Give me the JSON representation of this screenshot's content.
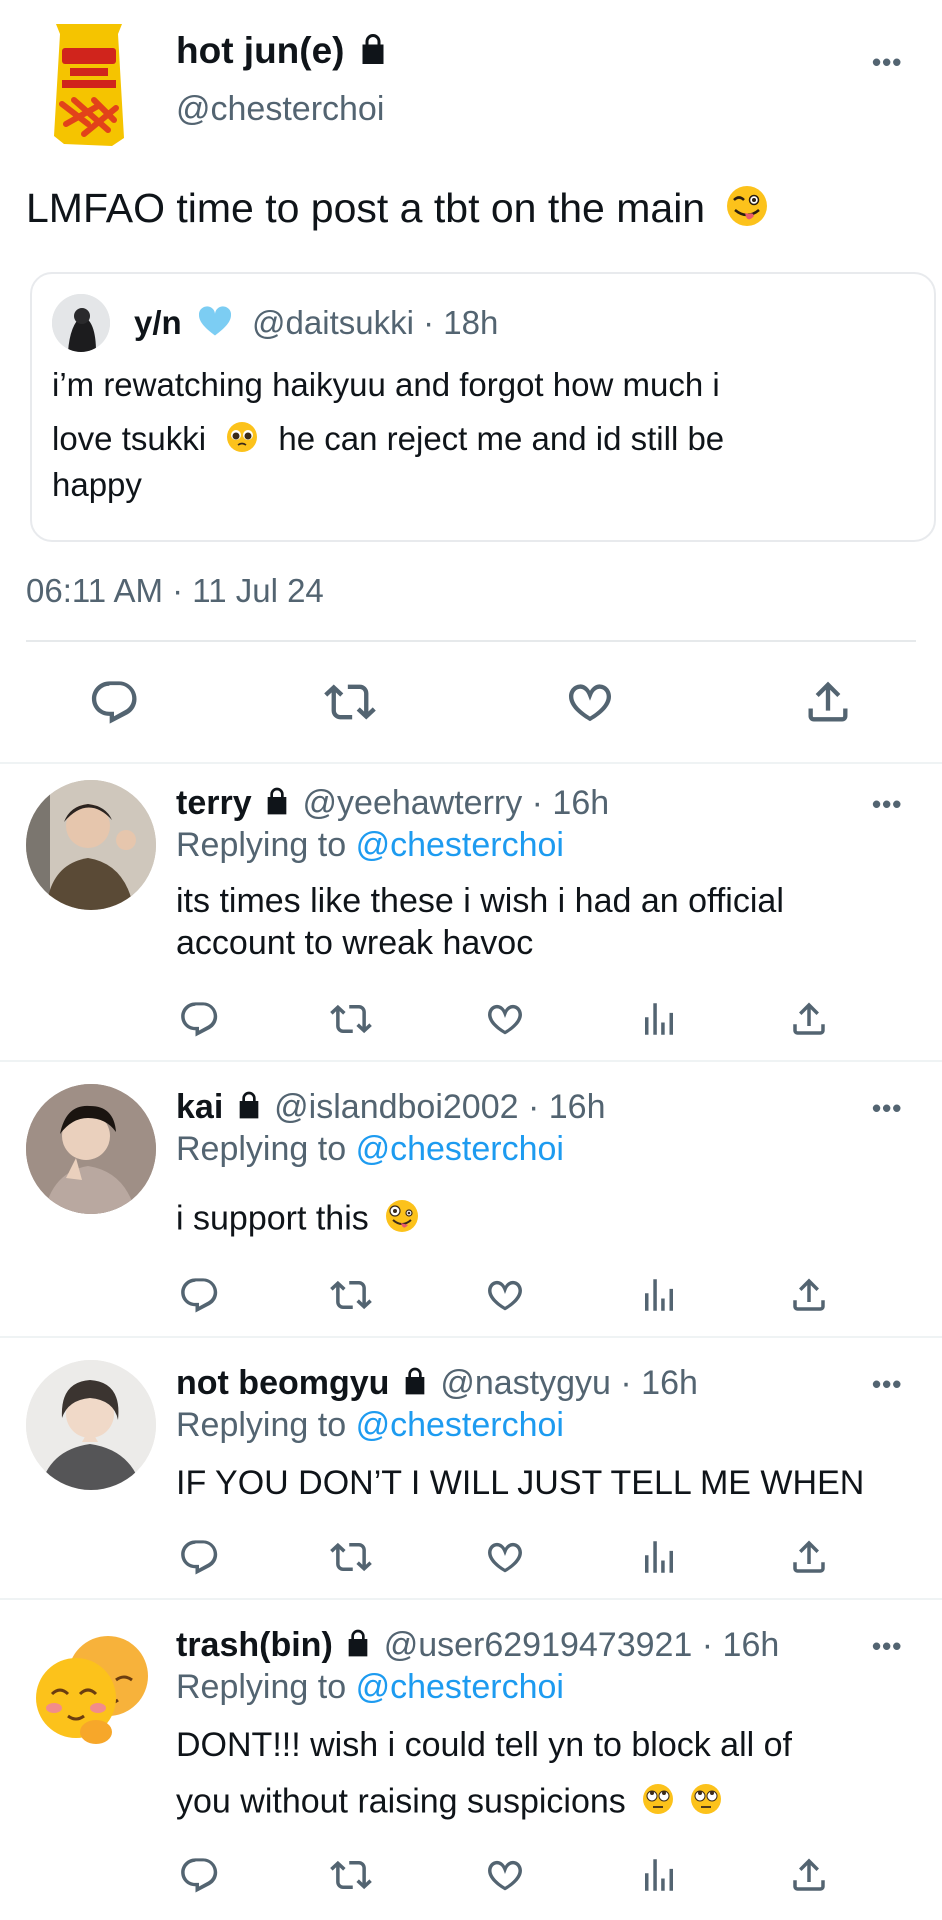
{
  "main": {
    "display_name": "hot jun(e)",
    "handle": "@chesterchoi",
    "text": "LMFAO time to post a tbt on the main",
    "timestamp": "06:11 AM · 11 Jul 24",
    "more": "•••",
    "quote": {
      "name": "y/n",
      "handle_time": "@daitsukki · 18h",
      "line1": "i’m rewatching haikyuu and forgot how much i",
      "line2a": "love tsukki",
      "line2b": "he can reject me and id still be",
      "line3": "happy"
    }
  },
  "replies": [
    {
      "name": "terry",
      "meta": "@yeehawterry · 16h",
      "replying": "Replying to",
      "mention": "@chesterchoi",
      "line1": "its times like these i wish i had an official",
      "line2": "account to wreak havoc"
    },
    {
      "name": "kai",
      "meta": "@islandboi2002 · 16h",
      "replying": "Replying to",
      "mention": "@chesterchoi",
      "line1": "i support this"
    },
    {
      "name": "not beomgyu",
      "meta": "@nastygyu · 16h",
      "replying": "Replying to",
      "mention": "@chesterchoi",
      "line1": "IF YOU DON’T I WILL JUST TELL ME WHEN"
    },
    {
      "name": "trash(bin)",
      "meta": "@user62919473921 · 16h",
      "replying": "Replying to",
      "mention": "@chesterchoi",
      "line1": "DONT!!! wish i could tell yn to block all of",
      "line2": "you without raising suspicions"
    }
  ],
  "icons": {
    "reply": "reply-icon",
    "retweet": "retweet-icon",
    "like": "like-icon",
    "views": "views-icon",
    "share": "share-icon",
    "lock": "lock-icon",
    "more": "more-icon"
  },
  "colors": {
    "link": "#1d9bf0",
    "secondary": "#536471",
    "divider": "#eff3f4",
    "text": "#0f1419"
  }
}
